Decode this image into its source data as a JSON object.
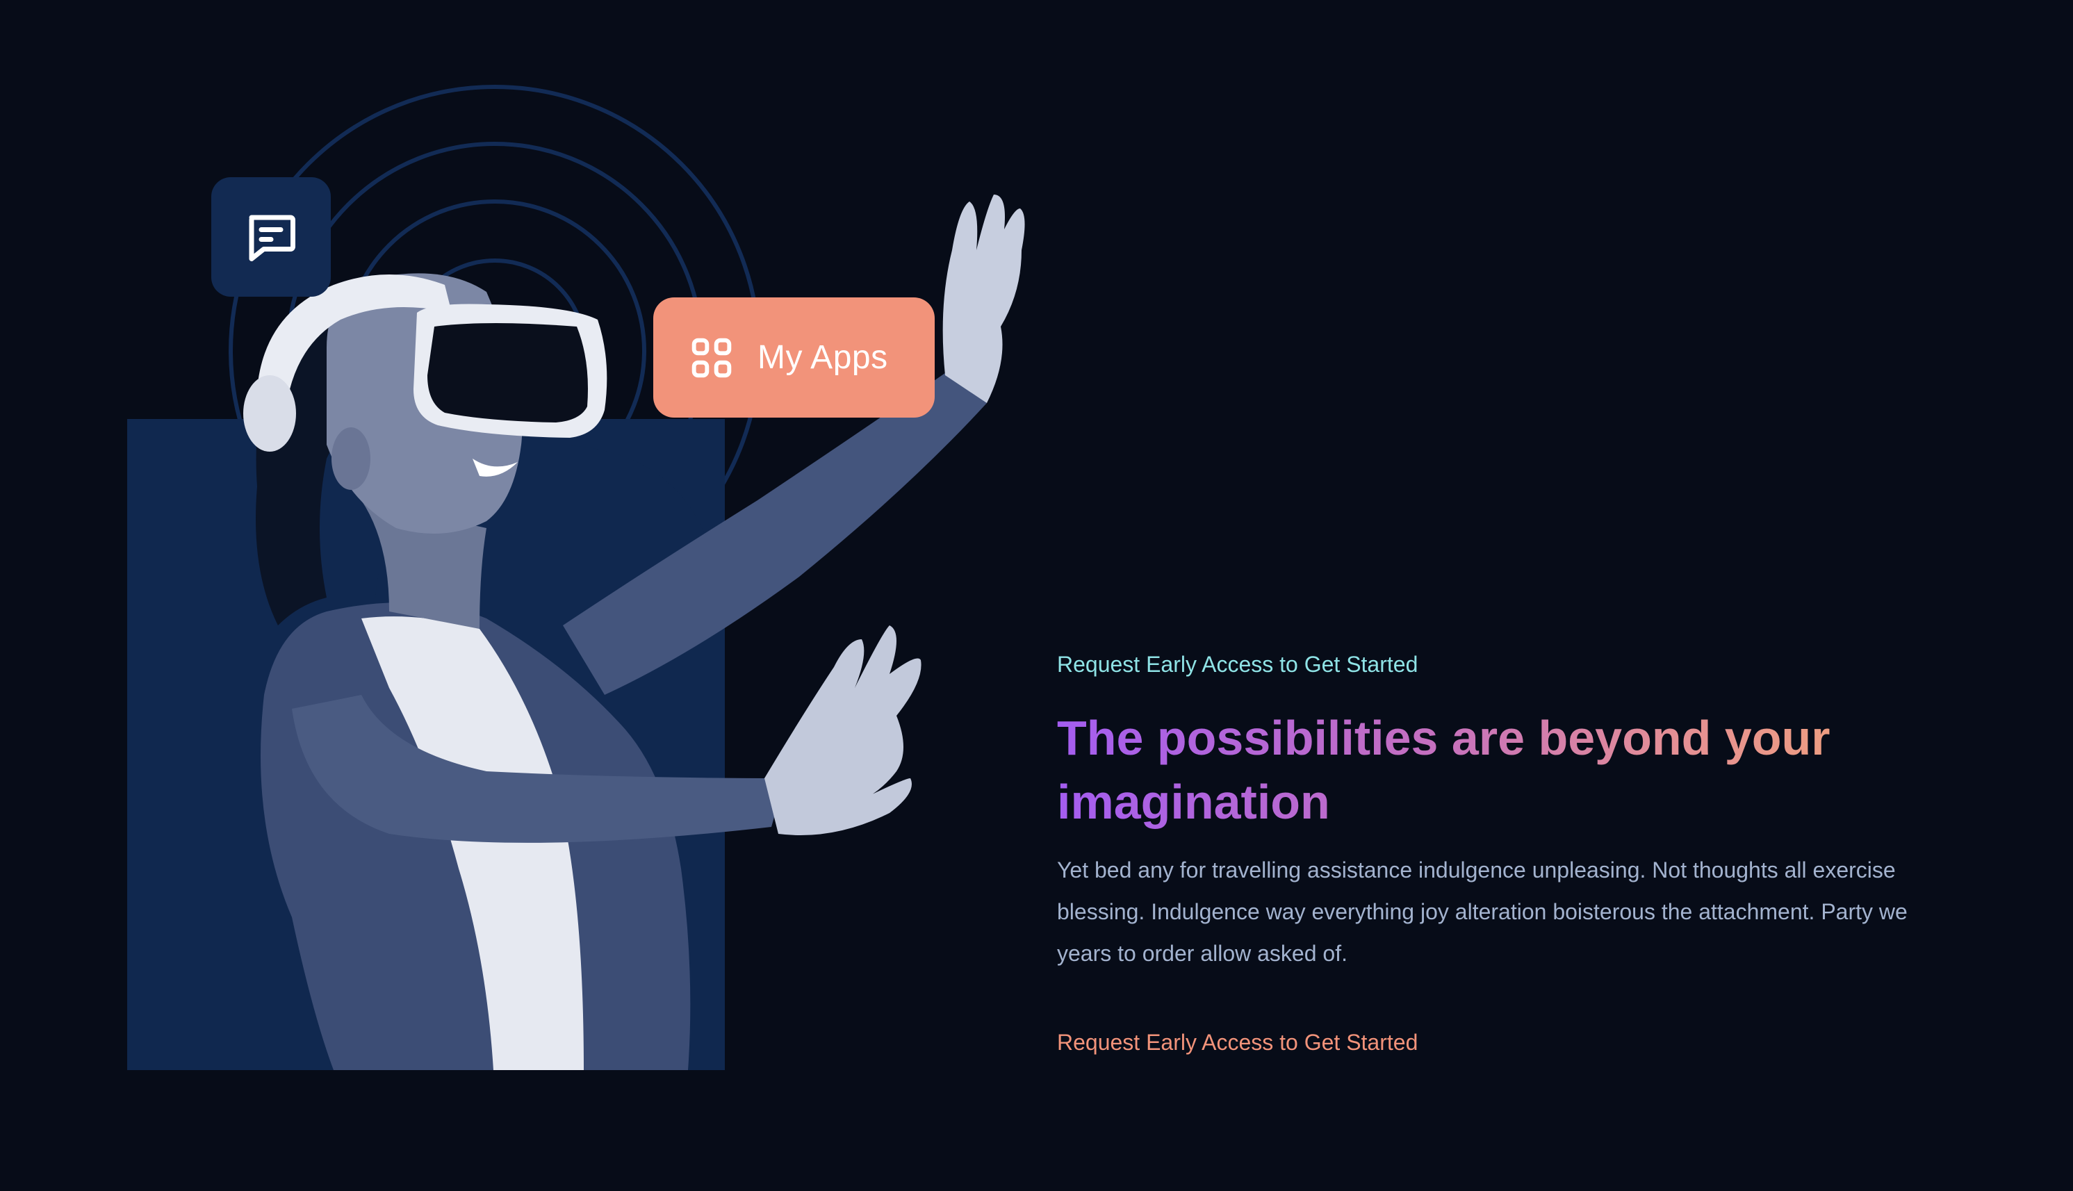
{
  "hero": {
    "chat_icon": "message-square-icon",
    "apps_pill": {
      "icon": "grid-apps-icon",
      "label": "My Apps"
    }
  },
  "content": {
    "eyebrow": "Request Early Access to Get Started",
    "headline": "The possibilities are beyond your imagination",
    "body": "Yet bed any for travelling assistance indulgence unpleasing. Not thoughts all exercise blessing. Indulgence way everything joy alteration boisterous the attachment. Party we years to order allow asked of.",
    "cta_label": "Request Early Access to Get Started"
  },
  "colors": {
    "background": "#070c18",
    "panel": "#10284f",
    "accent": "#f2937a",
    "eyebrow": "#8fe3e6",
    "gradient_start": "#a45df0",
    "gradient_end": "#f0a17c",
    "body_text": "#a3b3cf"
  }
}
